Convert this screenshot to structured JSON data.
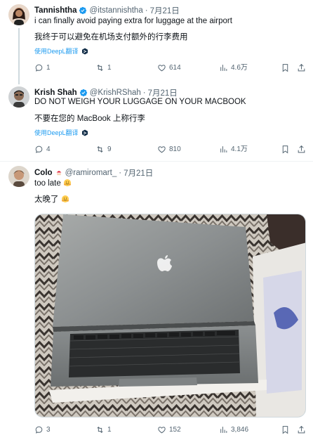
{
  "tweets": [
    {
      "name": "Tannishtha",
      "handle": "@itstannishtha",
      "dot": "·",
      "date": "7月21日",
      "text": "i can finally avoid paying extra for luggage at the airport",
      "translation": "我终于可以避免在机场支付额外的行李费用",
      "translate_link": "使用DeepL翻译",
      "replies": "1",
      "retweets": "1",
      "likes": "614",
      "views": "4.6万"
    },
    {
      "name": "Krish Shah",
      "handle": "@KrishRShah",
      "dot": "·",
      "date": "7月21日",
      "text": "DO NOT WEIGH YOUR LUGGAGE ON YOUR MACBOOK",
      "translation": "不要在您的 MacBook 上称行李",
      "translate_link": "使用DeepL翻译",
      "replies": "4",
      "retweets": "9",
      "likes": "810",
      "views": "4.1万"
    },
    {
      "name": "Colo",
      "handle": "@ramiromart_",
      "dot": "·",
      "date": "7月21日",
      "text": "too late",
      "translation": "太晚了",
      "replies": "3",
      "retweets": "1",
      "likes": "152",
      "views": "3,846"
    }
  ],
  "colors": {
    "accent": "#1d9bf0",
    "muted": "#536471",
    "text": "#0f1419",
    "divider": "#eff3f4"
  }
}
